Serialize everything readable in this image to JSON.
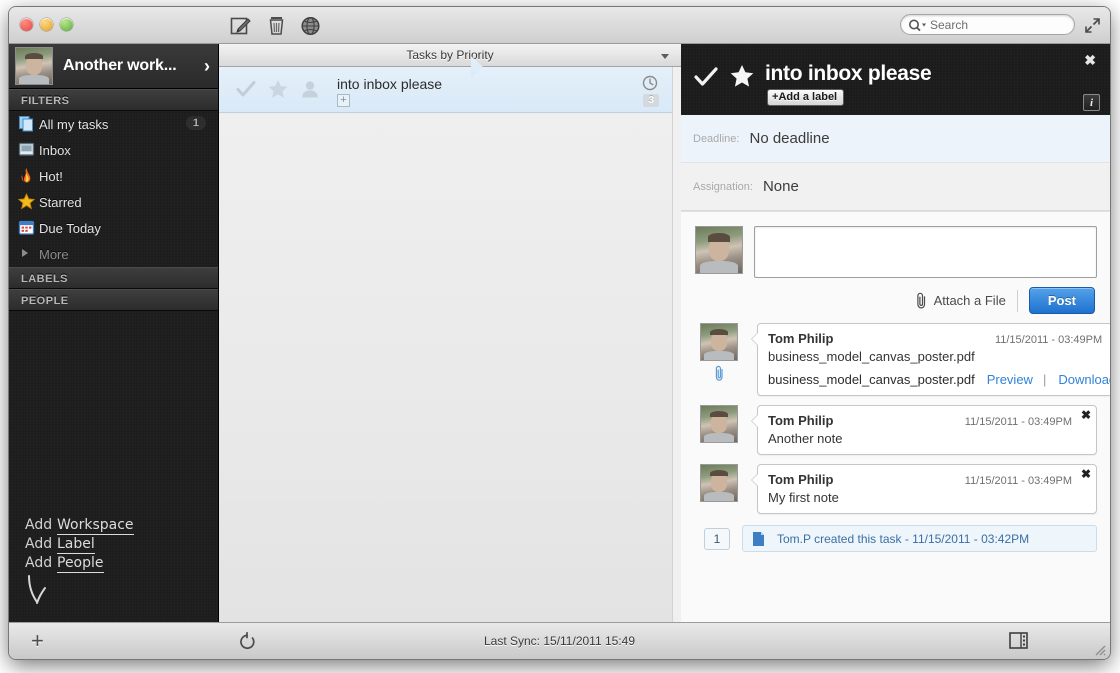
{
  "window": {
    "traffic_lights": [
      "close",
      "minimize",
      "zoom"
    ],
    "toolbar_icons": [
      "compose-icon",
      "trash-icon",
      "globe-icon"
    ],
    "search": {
      "placeholder": "Search",
      "value": "",
      "icon": "search-icon"
    },
    "expand_icon": "expand-icon"
  },
  "sidebar": {
    "workspace": {
      "name": "Another work...",
      "avatar": "user-avatar",
      "chevron": "›"
    },
    "sections": [
      {
        "title": "FILTERS"
      },
      {
        "title": "LABELS"
      },
      {
        "title": "PEOPLE"
      }
    ],
    "filters": [
      {
        "label": "All my tasks",
        "icon": "tasks-icon",
        "count": "1"
      },
      {
        "label": "Inbox",
        "icon": "inbox-icon",
        "count": ""
      },
      {
        "label": "Hot!",
        "icon": "flame-icon",
        "count": ""
      },
      {
        "label": "Starred",
        "icon": "star-icon",
        "count": ""
      },
      {
        "label": "Due Today",
        "icon": "calendar-icon",
        "count": ""
      }
    ],
    "more_label": "More",
    "sketch": {
      "add_word": "Add",
      "links": [
        "Workspace",
        "Label",
        "People"
      ],
      "arrow": "arrow-down-sketch"
    }
  },
  "tasklist": {
    "header_title": "Tasks by Priority",
    "sort_caret": "chevron-down-icon",
    "task": {
      "title": "into inbox please",
      "check_icon": "check-icon",
      "star_icon": "star-icon",
      "user_icon": "person-icon",
      "add_label_plus": "+",
      "clock_icon": "clock-icon",
      "badge": "3"
    }
  },
  "detail": {
    "title": "into inbox please",
    "check_icon": "check-icon",
    "star_icon": "star-icon",
    "add_label": "Add a label",
    "add_label_plus": "+",
    "close_icon": "✖",
    "info_icon": "i",
    "meta": [
      {
        "label": "Deadline:",
        "value": "No deadline"
      },
      {
        "label": "Assignation:",
        "value": "None"
      }
    ],
    "compose": {
      "placeholder": "",
      "value": "",
      "attach_label": "Attach a File",
      "attach_icon": "paperclip-icon",
      "post_label": "Post",
      "avatar": "user-avatar"
    },
    "notes": [
      {
        "author": "Tom Philip",
        "time": "11/15/2011 - 03:49PM",
        "text": "business_model_canvas_poster.pdf",
        "avatar": "user-avatar",
        "delete_icon": "✖",
        "has_clip": true,
        "attachment": {
          "name": "business_model_canvas_poster.pdf",
          "preview_label": "Preview",
          "separator": "|",
          "download_label": "Download"
        }
      },
      {
        "author": "Tom Philip",
        "time": "11/15/2011 - 03:49PM",
        "text": "Another note",
        "avatar": "user-avatar",
        "delete_icon": "✖",
        "has_clip": false,
        "attachment": null
      },
      {
        "author": "Tom Philip",
        "time": "11/15/2011 - 03:49PM",
        "text": "My first note",
        "avatar": "user-avatar",
        "delete_icon": "✖",
        "has_clip": false,
        "attachment": null
      }
    ],
    "activity": {
      "count": "1",
      "icon": "document-icon",
      "text": "Tom.P created this task - 11/15/2011 - 03:42PM"
    }
  },
  "statusbar": {
    "add_icon": "+",
    "sync_icon": "refresh-icon",
    "sync_text": "Last Sync: 15/11/2011 15:49",
    "panel_icon": "toggle-panel-icon",
    "resize_grip": "resize-grip-icon"
  },
  "colors": {
    "accent_blue": "#2f83d8",
    "post_button": "#1f71d0",
    "sidebar_bg": "#1d1d1d",
    "selected_row": "#dce9f6",
    "link_blue": "#3b6fa4"
  }
}
